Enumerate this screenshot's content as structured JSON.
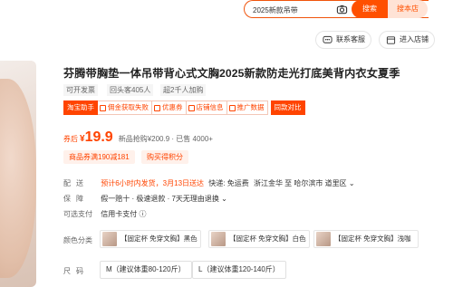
{
  "search": {
    "query": "2025新款吊带",
    "search_label": "搜索",
    "store_search_label": "搜本店"
  },
  "actions": {
    "contact_label": "联系客服",
    "enter_store_label": "进入店铺"
  },
  "product": {
    "title": "芬腾带胸垫一体吊带背心式文胸2025新款防走光打底美背内衣女夏季",
    "tags": [
      "可开发票",
      "回头客405人",
      "超2千人加购"
    ],
    "promo": {
      "lead": "淘宝助手",
      "items": [
        "佣金获取失败",
        "优惠券",
        "店铺信息",
        "推广数据"
      ],
      "tail": "同款对比"
    },
    "price": {
      "label": "券后",
      "currency": "¥",
      "value": "19.9",
      "original": "新品抢购¥200.9 · 已售 4000+"
    },
    "chips": [
      "商品券满190减181",
      "购买得积分"
    ],
    "delivery": {
      "label": "配送",
      "eta": "预计6小时内发货，3月13日送达",
      "method": "快递: 免运费",
      "route": "浙江金华 至 哈尔滨市 道里区",
      "chevron": "⌄"
    },
    "guarantee": {
      "label": "保障",
      "text": "假一赔十 · 极速退款 · 7天无理由退换",
      "chevron": "⌄"
    },
    "payment": {
      "label": "可选支付",
      "text": "信用卡支付",
      "info": "ⓘ"
    },
    "color": {
      "label": "颜色分类",
      "options": [
        "【固定杯 免穿文胸】黑色",
        "【固定杯 免穿文胸】白色",
        "【固定杯 免穿文胸】浅咖"
      ]
    },
    "size": {
      "label": "尺码",
      "options": [
        "M（建议体重80-120斤）",
        "L（建议体重120-140斤）"
      ]
    }
  },
  "colors": {
    "accent": "#ff5000",
    "price": "#ff4400"
  }
}
